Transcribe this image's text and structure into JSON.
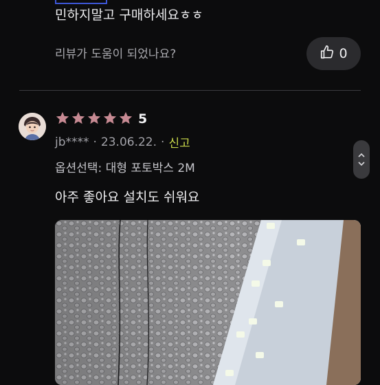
{
  "previous_review": {
    "text_line1": "민하지말고 구매하세요ㅎㅎ",
    "helpful_question": "리뷰가 도움이 되었나요?",
    "like_count": "0"
  },
  "review": {
    "rating": 5,
    "rating_text": "5",
    "user": "jb****",
    "date": "23.06.22.",
    "report_label": "신고",
    "option": "옵션선택: 대형 포토박스 2M",
    "text": "아주 좋아요 설치도 쉬워요"
  },
  "colors": {
    "star": "#c78a93",
    "report": "#c9d94a",
    "background": "#0c0c0d"
  },
  "icons": {
    "like": "thumbs-up-icon",
    "scroll_up": "chevron-up-icon",
    "scroll_down": "chevron-down-icon"
  }
}
